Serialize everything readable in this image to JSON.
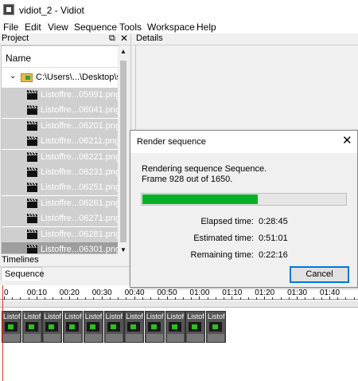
{
  "window": {
    "title": "vidiot_2 - Vidiot"
  },
  "menu": [
    "File",
    "Edit",
    "View",
    "Sequence",
    "Tools",
    "Workspace",
    "Help"
  ],
  "project": {
    "header": "Project",
    "column": "Name",
    "folder": "C:\\Users\\...\\Desktop\\s",
    "files": [
      "Listoffre...05991.png",
      "Listoffre...06041.png",
      "Listoffre...06201.png",
      "Listoffre...06211.png",
      "Listoffre...06221.png",
      "Listoffre...06231.png",
      "Listoffre...06251.png",
      "Listoffre...06261.png",
      "Listoffre...06271.png",
      "Listoffre...06281.png",
      "Listoffre...06301.png"
    ]
  },
  "details": {
    "header": "Details"
  },
  "timelines": {
    "header": "Timelines",
    "tab": "Sequence",
    "ruler": [
      "0",
      "00:10",
      "00:20",
      "00:30",
      "00:40",
      "00:50",
      "01:00",
      "01:10",
      "01:20",
      "01:30",
      "01:40"
    ],
    "clip_label": "Listof"
  },
  "dialog": {
    "title": "Render sequence",
    "message": "Rendering sequence Sequence.",
    "frame": "Frame 928 out of 1650.",
    "progress": 0.5624,
    "elapsed_label": "Elapsed time:",
    "elapsed": "0:28:45",
    "estimated_label": "Estimated time:",
    "estimated": "0:51:01",
    "remaining_label": "Remaining time:",
    "remaining": "0:22:16",
    "cancel": "Cancel"
  },
  "colors": {
    "progress": "#06b025",
    "playhead": "#e23a1e",
    "accent": "#0078d7"
  }
}
